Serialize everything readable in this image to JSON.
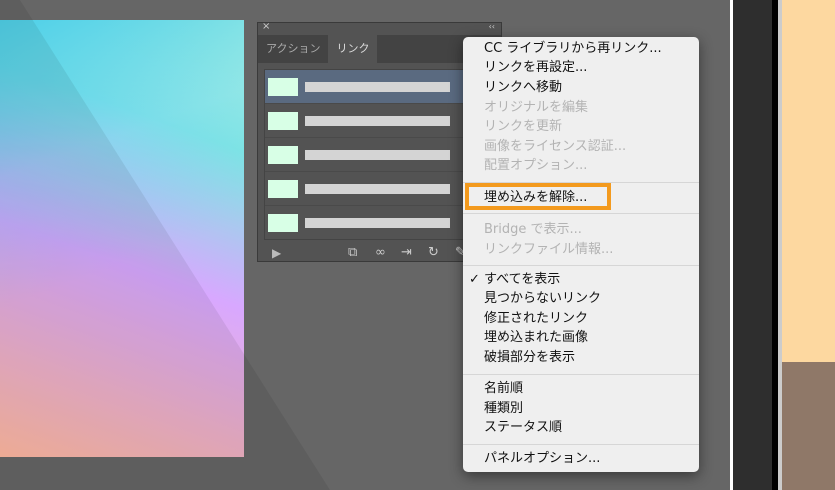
{
  "panel": {
    "close": "×",
    "collapse": "‹‹",
    "tabs": [
      "アクション",
      "リンク"
    ],
    "row_count": 5
  },
  "menu": {
    "items": [
      {
        "label": "CC ライブラリから再リンク...",
        "enabled": true
      },
      {
        "label": "リンクを再設定...",
        "enabled": true
      },
      {
        "label": "リンクへ移動",
        "enabled": true
      },
      {
        "label": "オリジナルを編集",
        "enabled": false
      },
      {
        "label": "リンクを更新",
        "enabled": false
      },
      {
        "label": "画像をライセンス認証...",
        "enabled": false
      },
      {
        "label": "配置オプション...",
        "enabled": false
      },
      {
        "label": "埋め込みを解除...",
        "enabled": true
      },
      {
        "label": "Bridge で表示...",
        "enabled": false
      },
      {
        "label": "リンクファイル情報...",
        "enabled": false
      },
      {
        "label": "すべてを表示",
        "enabled": true
      },
      {
        "label": "見つからないリンク",
        "enabled": true
      },
      {
        "label": "修正されたリンク",
        "enabled": true
      },
      {
        "label": "埋め込まれた画像",
        "enabled": true
      },
      {
        "label": "破損部分を表示",
        "enabled": true
      },
      {
        "label": "名前順",
        "enabled": true
      },
      {
        "label": "種類別",
        "enabled": true
      },
      {
        "label": "ステータス順",
        "enabled": true
      },
      {
        "label": "パネルオプション...",
        "enabled": true
      }
    ],
    "checkmark": "✓",
    "highlight_color": "#f39a1e"
  }
}
